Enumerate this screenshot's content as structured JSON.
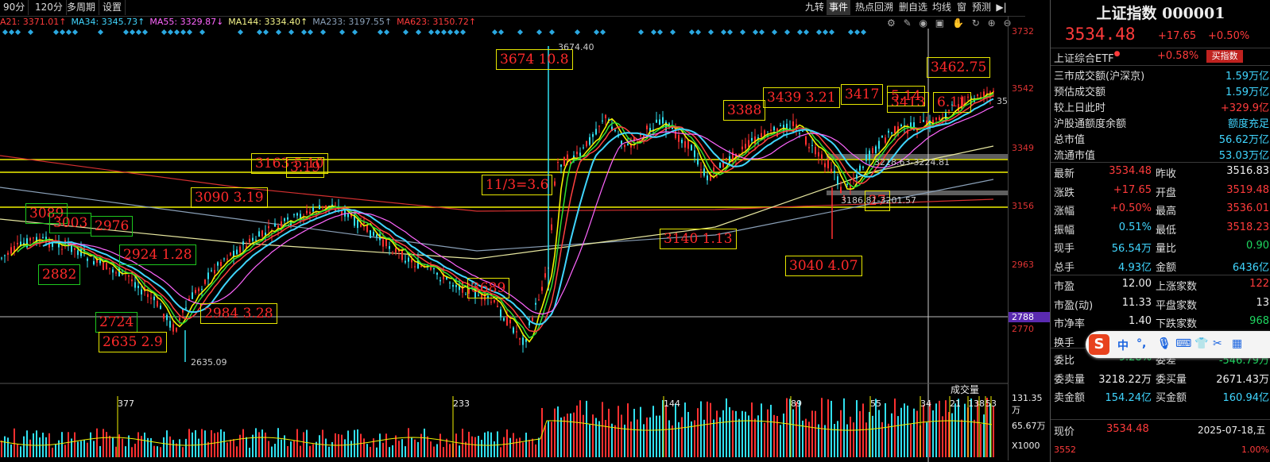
{
  "topbar": {
    "left_tabs": [
      "90分",
      "120分",
      "多周期",
      "设置"
    ],
    "right_tabs": [
      "九转",
      "事件",
      "热点回溯",
      "删自选",
      "均线",
      "窗",
      "预测",
      "▶|"
    ],
    "active_right": "事件"
  },
  "ma_legend": [
    {
      "text": "A21: 3371.01↑",
      "color": "#ff3b3b"
    },
    {
      "text": "MA34: 3345.73↑",
      "color": "#40d6ff"
    },
    {
      "text": "MA55: 3329.87↓",
      "color": "#ff66ff"
    },
    {
      "text": "MA144: 3334.40↑",
      "color": "#f5f58a"
    },
    {
      "text": "MA233: 3197.55↑",
      "color": "#8aa0b8"
    },
    {
      "text": "MA623: 3150.72↑",
      "color": "#ff3b3b"
    }
  ],
  "price_axis": {
    "ticks": [
      "3732",
      "3542",
      "3349",
      "3156",
      "2963",
      "2788",
      "2770"
    ],
    "highlight_tick": "2788"
  },
  "volume_axis": {
    "ticks": [
      "131.35万",
      "65.67万",
      "X1000"
    ],
    "title": "成交量"
  },
  "annotations": [
    {
      "text": "3674   10.8",
      "color": "yellow"
    },
    {
      "text": "11/3=3.6",
      "color": "yellow"
    },
    {
      "text": "3163     5.10",
      "color": "yellow"
    },
    {
      "text": "3090    3.19",
      "color": "yellow"
    },
    {
      "text": "3089",
      "color": "green"
    },
    {
      "text": "3003",
      "color": "green"
    },
    {
      "text": "2976",
      "color": "green"
    },
    {
      "text": "2924      1.28",
      "color": "green"
    },
    {
      "text": "2882",
      "color": "green"
    },
    {
      "text": "2984     3.28",
      "color": "yellow"
    },
    {
      "text": "2724",
      "color": "green"
    },
    {
      "text": "2635    2.9",
      "color": "yellow"
    },
    {
      "text": "3140   1.13",
      "color": "yellow"
    },
    {
      "text": "3040   4.07",
      "color": "yellow"
    },
    {
      "text": "3388",
      "color": "yellow"
    },
    {
      "text": "3439  3.21",
      "color": "yellow"
    },
    {
      "text": "3417",
      "color": "yellow"
    },
    {
      "text": "3413",
      "color": "yellow"
    },
    {
      "text": "3462.75",
      "color": "yellow"
    },
    {
      "text": "6.11",
      "color": "yellow"
    },
    {
      "text": "3689",
      "color": "yellow"
    },
    {
      "text": "5.14",
      "color": "yellow"
    },
    {
      "text": "27",
      "color": "yellow"
    },
    {
      "text": "3.19",
      "color": "yellow"
    }
  ],
  "small_labels": {
    "high": "3674.40",
    "low": "2635.09",
    "range1": "3186.81-3201.57",
    "range2": "3218.63-3224.81",
    "right_edge": "35"
  },
  "volume_counts": [
    "377",
    "233",
    "144",
    "89",
    "55",
    "34",
    "21",
    "13",
    "8",
    "5",
    "3"
  ],
  "panel": {
    "title": "上证指数 000001",
    "price": "3534.48",
    "change": "+17.65",
    "change_pct": "+0.50%",
    "etf_name": "上证综合ETF",
    "etf_pct": "+0.58%",
    "buy_btn": "买指数",
    "stats1": [
      {
        "label": "三市成交额(沪深京)",
        "value": "1.59万亿",
        "color": "cyan"
      },
      {
        "label": "预估成交额",
        "value": "1.59万亿",
        "color": "cyan"
      },
      {
        "label": "较上日此时",
        "value": "+329.9亿",
        "color": "red"
      },
      {
        "label": "沪股通额度余额",
        "value": "额度充足",
        "color": "cyan"
      },
      {
        "label": "总市值",
        "value": "56.62万亿",
        "color": "cyan"
      },
      {
        "label": "流通市值",
        "value": "53.03万亿",
        "color": "cyan"
      }
    ],
    "stats2": [
      {
        "l1": "最新",
        "v1": "3534.48",
        "c1": "red",
        "l2": "昨收",
        "v2": "3516.83",
        "c2": "white"
      },
      {
        "l1": "涨跌",
        "v1": "+17.65",
        "c1": "red",
        "l2": "开盘",
        "v2": "3519.48",
        "c2": "red"
      },
      {
        "l1": "涨幅",
        "v1": "+0.50%",
        "c1": "red",
        "l2": "最高",
        "v2": "3536.01",
        "c2": "red"
      },
      {
        "l1": "振幅",
        "v1": "0.51%",
        "c1": "cyan",
        "l2": "最低",
        "v2": "3518.23",
        "c2": "red"
      },
      {
        "l1": "现手",
        "v1": "56.54万",
        "c1": "cyan",
        "l2": "量比",
        "v2": "0.90",
        "c2": "green"
      },
      {
        "l1": "总手",
        "v1": "4.93亿",
        "c1": "cyan",
        "l2": "金额",
        "v2": "6436亿",
        "c2": "cyan"
      }
    ],
    "stats3": [
      {
        "l1": "市盈",
        "v1": "12.00",
        "c1": "white",
        "l2": "上涨家数",
        "v2": "122",
        "c2": "red"
      },
      {
        "l1": "市盈(动)",
        "v1": "11.33",
        "c1": "white",
        "l2": "平盘家数",
        "v2": "13",
        "c2": "white"
      },
      {
        "l1": "市净率",
        "v1": "1.40",
        "c1": "white",
        "l2": "下跌家数",
        "v2": "968",
        "c2": "green"
      },
      {
        "l1": "换手",
        "v1": "",
        "c1": "white",
        "l2": "",
        "v2": "",
        "c2": "white"
      }
    ],
    "stats4": [
      {
        "l1": "委比",
        "v1": "-9.28%",
        "c1": "green",
        "l2": "委差",
        "v2": "-546.79万",
        "c2": "green"
      },
      {
        "l1": "委卖量",
        "v1": "3218.22万",
        "c1": "white",
        "l2": "委买量",
        "v2": "2671.43万",
        "c2": "white"
      },
      {
        "l1": "卖金额",
        "v1": "154.24亿",
        "c1": "cyan",
        "l2": "买金额",
        "v2": "160.94亿",
        "c2": "cyan"
      }
    ],
    "bottom": {
      "l1": "现价",
      "v1": "3534.48",
      "date": "2025-07-18,五",
      "low": "3552",
      "pct": "1.00%"
    }
  },
  "ime_bar": {
    "items": [
      "中",
      "°,",
      "mic",
      "keyboard",
      "shirt",
      "tools",
      "grid"
    ]
  }
}
